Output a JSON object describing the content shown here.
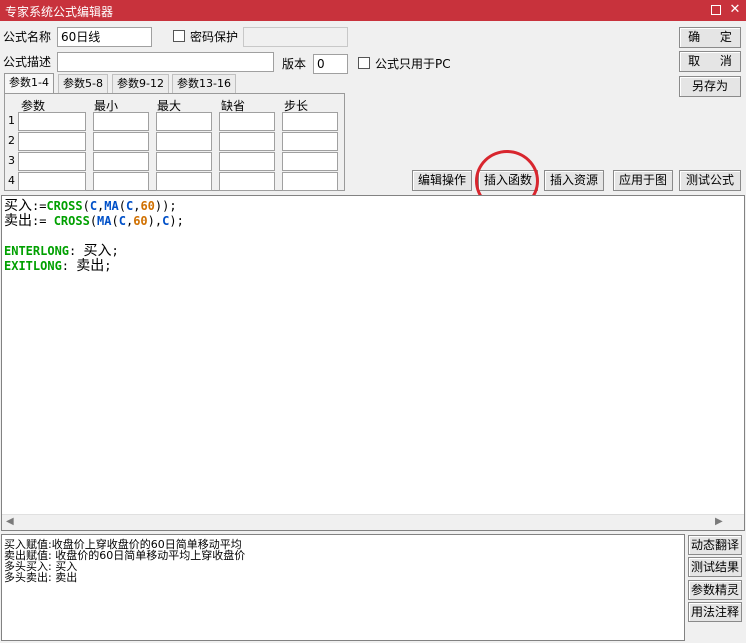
{
  "window": {
    "title": "专家系统公式编辑器",
    "maximize_icon": "maximize-icon",
    "close_icon": "close-icon",
    "close_glyph": "✕"
  },
  "form": {
    "name_label": "公式名称",
    "name_value": "60日线",
    "password_label": "密码保护",
    "password_value": "",
    "desc_label": "公式描述",
    "desc_value": "",
    "version_label": "版本",
    "version_value": "0",
    "pc_only_label": "公式只用于PC"
  },
  "buttons": {
    "ok": "确 定",
    "cancel": "取 消",
    "save_as": "另存为",
    "edit_ops": "编辑操作",
    "insert_func": "插入函数",
    "insert_res": "插入资源",
    "apply_chart": "应用于图",
    "test_formula": "测试公式"
  },
  "param_tabs": [
    "参数1-4",
    "参数5-8",
    "参数9-12",
    "参数13-16"
  ],
  "param_table": {
    "headers": [
      "参数",
      "最小",
      "最大",
      "缺省",
      "步长"
    ],
    "rows": [
      "1",
      "2",
      "3",
      "4"
    ]
  },
  "code": {
    "line1": {
      "var": "买入",
      "op": ":=",
      "fn1": "CROSS",
      "p1": "(",
      "a1": "C",
      "c1": ",",
      "fn2": "MA",
      "p2": "(",
      "a2": "C",
      "c2": ",",
      "n": "60",
      "end": "));"
    },
    "line2": {
      "var": "卖出",
      "op": ":= ",
      "fn1": "CROSS",
      "p1": "(",
      "fn2": "MA",
      "p2": "(",
      "a1": "C",
      "c1": ",",
      "n": "60",
      "c2": "),",
      "a2": "C",
      "end": ");"
    },
    "line3": {
      "kw": "ENTERLONG",
      "sep": ": ",
      "val": "买入",
      "end": ";"
    },
    "line4": {
      "kw": "EXITLONG",
      "sep": ": ",
      "val": "卖出",
      "end": ";"
    },
    "scroll_left": "◀",
    "scroll_right": "▶"
  },
  "notes": [
    "买入赋值:收盘价上穿收盘价的60日简单移动平均",
    "卖出赋值: 收盘价的60日简单移动平均上穿收盘价",
    "多头买入: 买入",
    "多头卖出: 卖出"
  ],
  "side_buttons": [
    "动态翻译",
    "测试结果",
    "参数精灵",
    "用法注释"
  ],
  "colors": {
    "titlebar": "#c8323c",
    "highlight": "#d8262e",
    "keyword_green": "#00a000",
    "function_blue": "#0050c8",
    "number_orange": "#d07000"
  }
}
